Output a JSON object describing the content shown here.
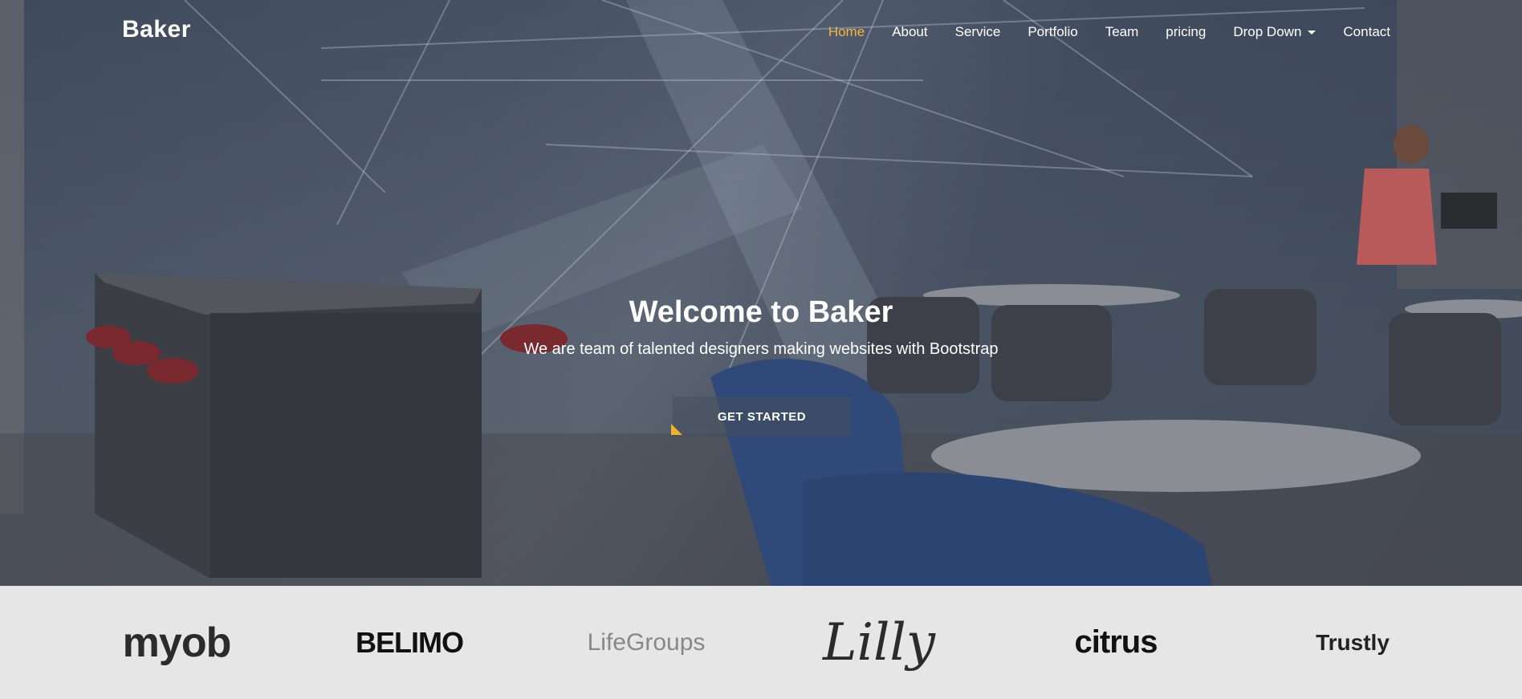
{
  "brand": "Baker",
  "nav": {
    "items": [
      {
        "label": "Home",
        "active": true
      },
      {
        "label": "About"
      },
      {
        "label": "Service"
      },
      {
        "label": "Portfolio"
      },
      {
        "label": "Team"
      },
      {
        "label": "pricing"
      },
      {
        "label": "Drop Down",
        "dropdown": true
      },
      {
        "label": "Contact"
      }
    ]
  },
  "hero": {
    "title": "Welcome to Baker",
    "subtitle": "We are team of talented designers making websites with Bootstrap",
    "cta_label": "GET STARTED"
  },
  "clients": [
    {
      "name": "myob"
    },
    {
      "name": "BELIMO"
    },
    {
      "name": "LifeGroups"
    },
    {
      "name": "Lilly"
    },
    {
      "name": "citrus"
    },
    {
      "name": "Trustly"
    }
  ],
  "colors": {
    "accent": "#f5b73b",
    "nav_text": "#ffffff",
    "clients_bg": "#e6e6e6"
  }
}
